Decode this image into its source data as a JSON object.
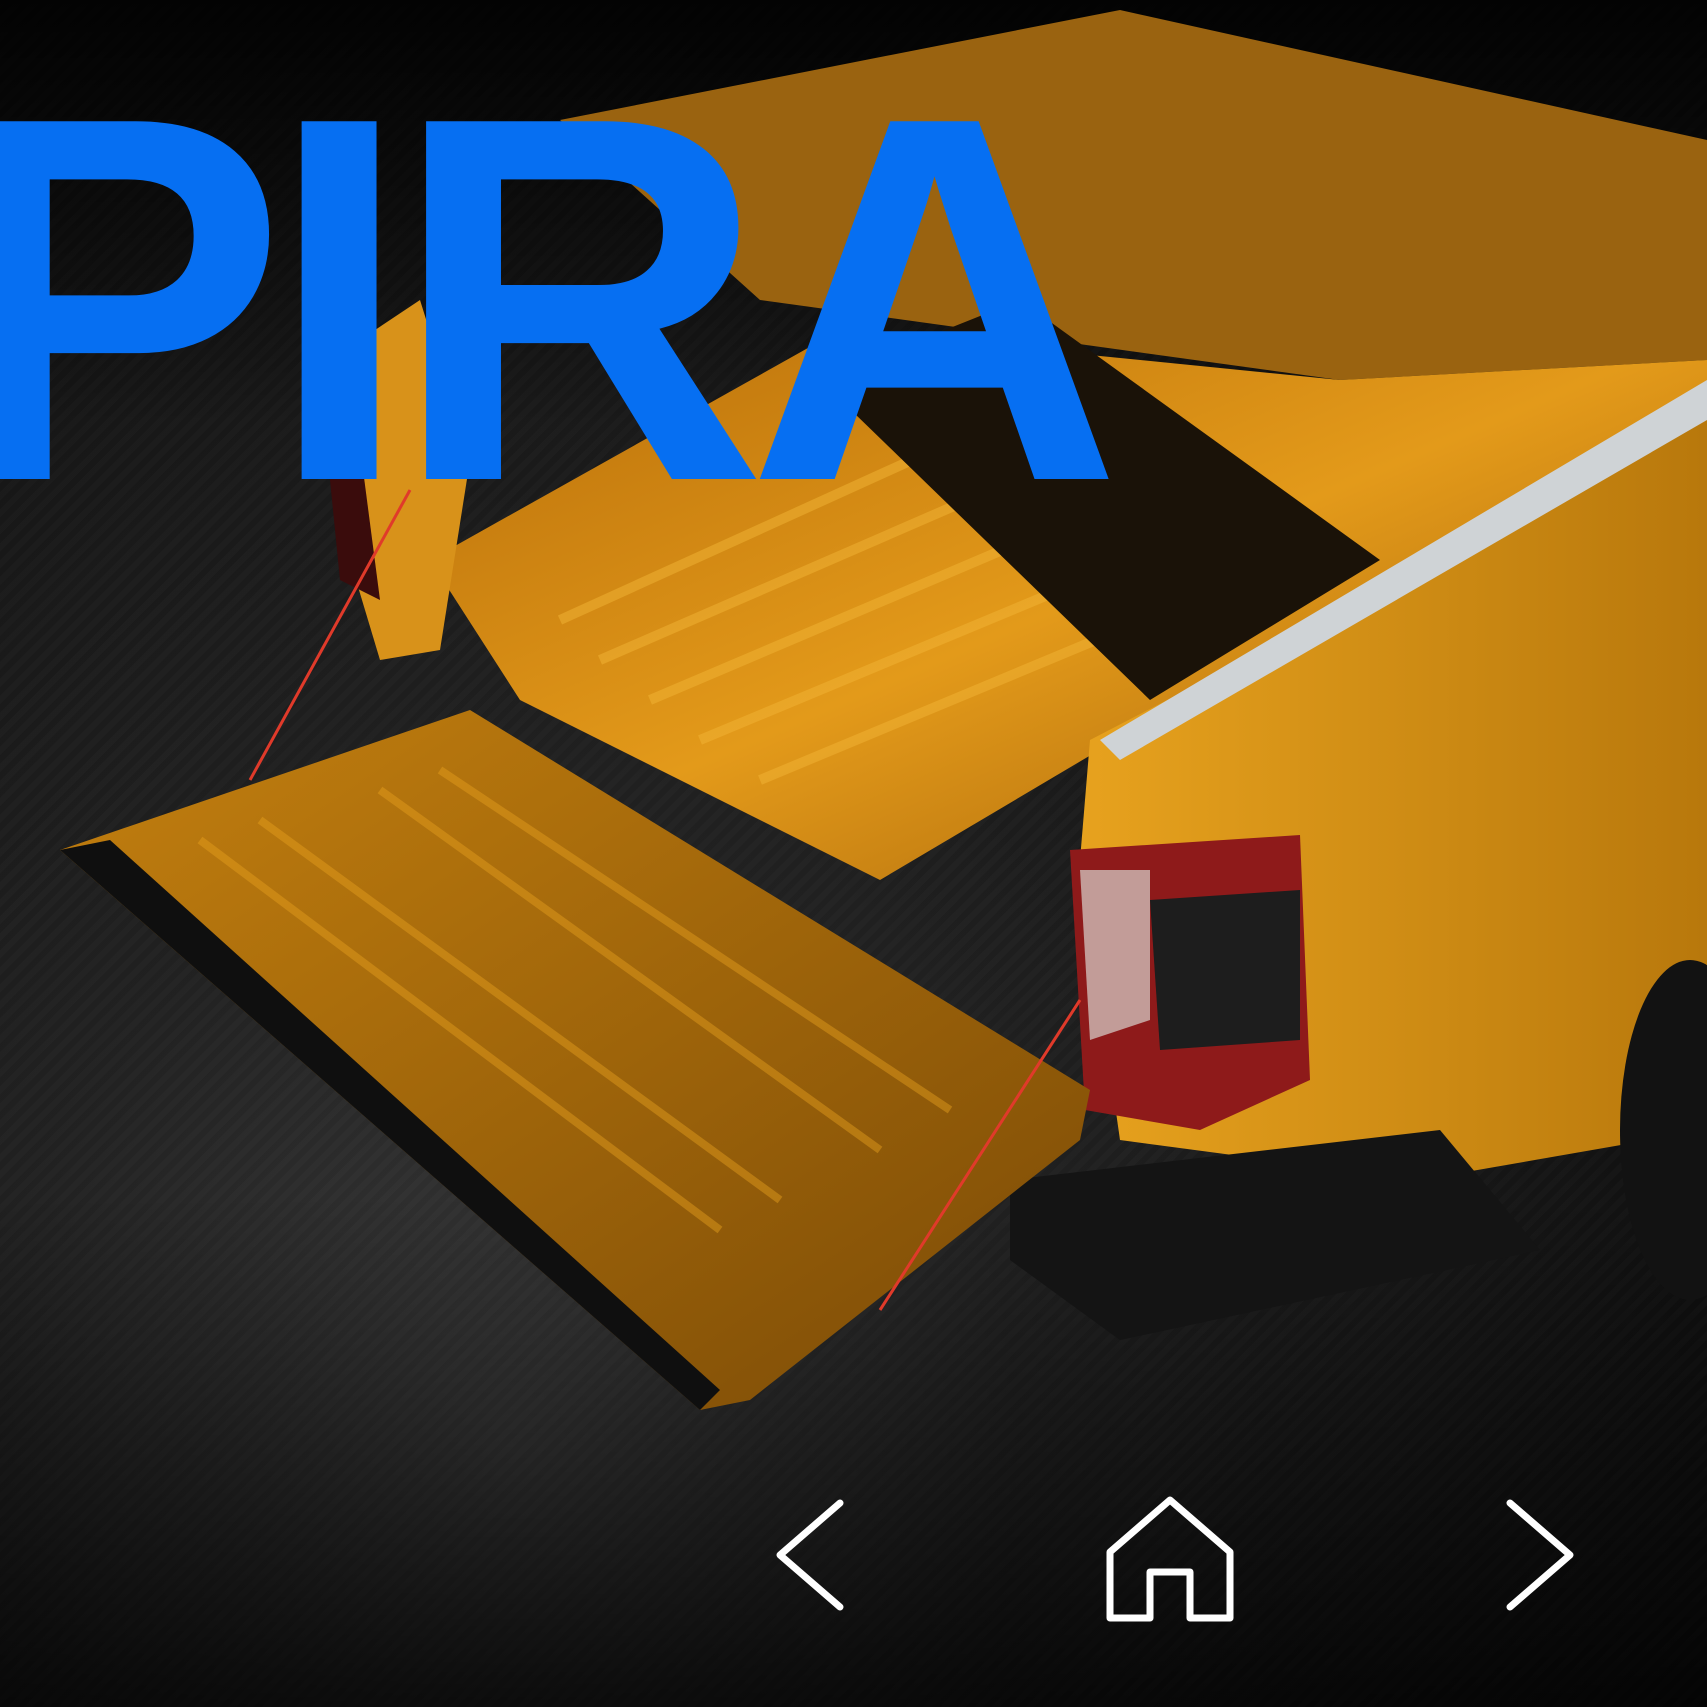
{
  "hero": {
    "headline": "PIRA"
  },
  "navigation": {
    "previous_icon": "chevron-left-icon",
    "home_icon": "home-icon",
    "next_icon": "chevron-right-icon"
  },
  "colors": {
    "headline": "#066ff2",
    "icon_stroke": "#ffffff",
    "truck_paint": "#e8a018",
    "background": "#0d0f12"
  }
}
